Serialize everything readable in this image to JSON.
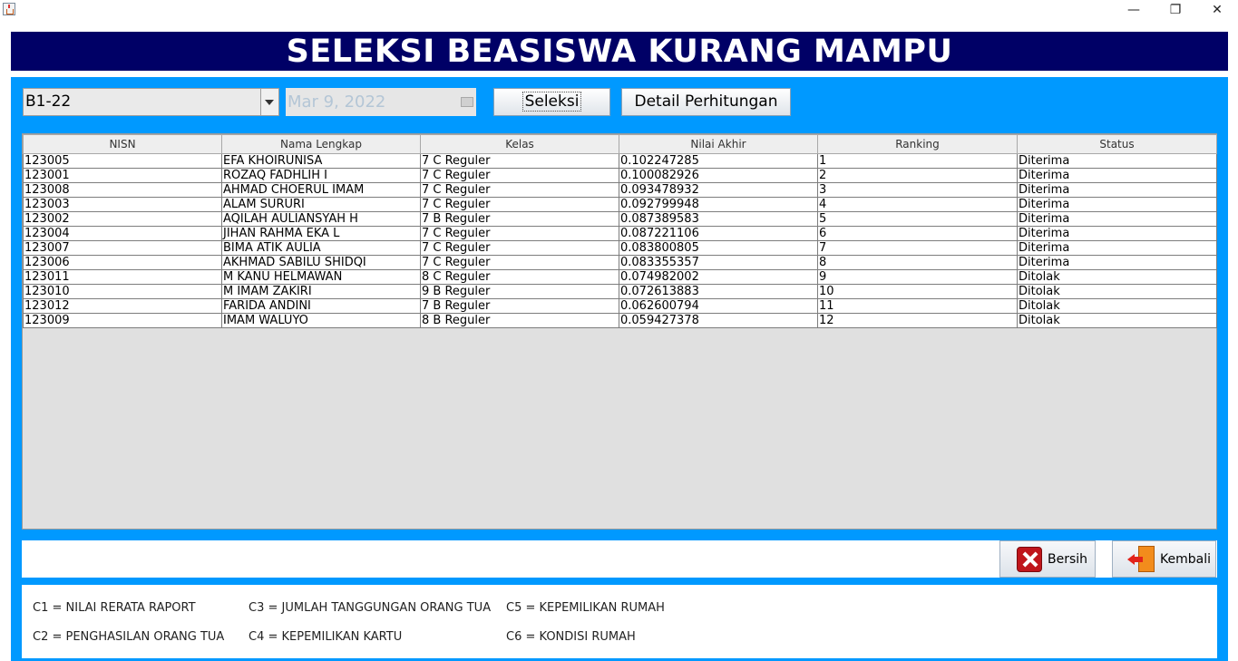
{
  "window": {
    "minimize_glyph": "—",
    "restore_glyph": "❐",
    "close_glyph": "✕"
  },
  "header": {
    "title": "SELEKSI BEASISWA KURANG MAMPU"
  },
  "controls": {
    "period_value": "B1-22",
    "date_value": "Mar 9, 2022",
    "seleksi_label": "Seleksi",
    "detail_label": "Detail Perhitungan"
  },
  "table": {
    "columns": [
      "NISN",
      "Nama Lengkap",
      "Kelas",
      "Nilai Akhir",
      "Ranking",
      "Status"
    ],
    "rows": [
      [
        "123005",
        "EFA KHOIRUNISA",
        "7 C Reguler",
        "0.102247285",
        "1",
        "Diterima"
      ],
      [
        "123001",
        "ROZAQ FADHLIH I",
        "7 C Reguler",
        "0.100082926",
        "2",
        "Diterima"
      ],
      [
        "123008",
        "AHMAD CHOERUL IMAM",
        "7 C Reguler",
        "0.093478932",
        "3",
        "Diterima"
      ],
      [
        "123003",
        "ALAM SURURI",
        "7 C Reguler",
        "0.092799948",
        "4",
        "Diterima"
      ],
      [
        "123002",
        "AQILAH AULIANSYAH H",
        "7 B Reguler",
        "0.087389583",
        "5",
        "Diterima"
      ],
      [
        "123004",
        "JIHAN RAHMA EKA L",
        "7 C Reguler",
        "0.087221106",
        "6",
        "Diterima"
      ],
      [
        "123007",
        "BIMA ATIK AULIA",
        "7 C Reguler",
        "0.083800805",
        "7",
        "Diterima"
      ],
      [
        "123006",
        "AKHMAD SABILU SHIDQI",
        "7 C Reguler",
        "0.083355357",
        "8",
        "Diterima"
      ],
      [
        "123011",
        "M KANU HELMAWAN",
        "8 C Reguler",
        "0.074982002",
        "9",
        "Ditolak"
      ],
      [
        "123010",
        "M IMAM ZAKIRI",
        "9 B Reguler",
        "0.072613883",
        "10",
        "Ditolak"
      ],
      [
        "123012",
        "FARIDA ANDINI",
        "7 B Reguler",
        "0.062600794",
        "11",
        "Ditolak"
      ],
      [
        "123009",
        "IMAM WALUYO",
        "8 B Reguler",
        "0.059427378",
        "12",
        "Ditolak"
      ]
    ]
  },
  "actions": {
    "bersih_label": "Bersih",
    "kembali_label": "Kembali"
  },
  "legend": {
    "c1": "C1 = NILAI RERATA RAPORT",
    "c2": "C2 = PENGHASILAN ORANG TUA",
    "c3": "C3 = JUMLAH TANGGUNGAN ORANG TUA",
    "c4": "C4 = KEPEMILIKAN KARTU",
    "c5": "C5 = KEPEMILIKAN RUMAH",
    "c6": "C6 = KONDISI RUMAH"
  },
  "colors": {
    "header_bg": "#000066",
    "panel_bg": "#0099ff",
    "bersih_icon": "#c0151b",
    "kembali_icon": "#f28c1c"
  },
  "icons": [
    "java-app-icon",
    "chevron-down-icon",
    "calendar-icon",
    "close-x-icon",
    "exit-door-icon"
  ]
}
